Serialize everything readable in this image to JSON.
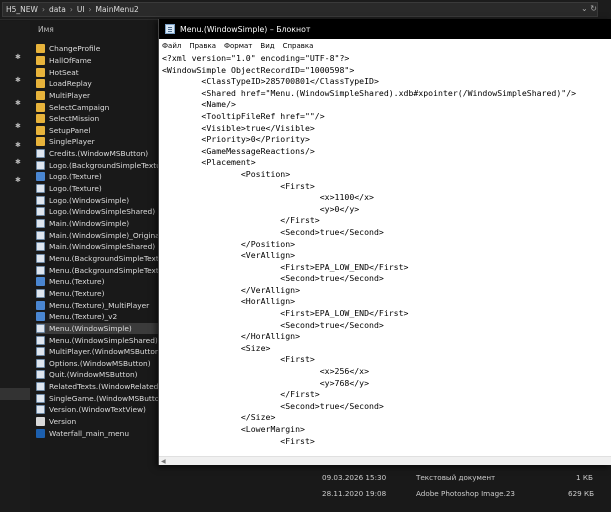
{
  "address_bar": {
    "crumbs": [
      "H5_NEW",
      "data",
      "UI",
      "MainMenu2"
    ]
  },
  "list_header": {
    "name_col": "Имя"
  },
  "files": [
    {
      "name": "ChangeProfile",
      "icon": "folder"
    },
    {
      "name": "HallOfFame",
      "icon": "folder"
    },
    {
      "name": "HotSeat",
      "icon": "folder"
    },
    {
      "name": "LoadReplay",
      "icon": "folder"
    },
    {
      "name": "MultiPlayer",
      "icon": "folder"
    },
    {
      "name": "SelectCampaign",
      "icon": "folder"
    },
    {
      "name": "SelectMission",
      "icon": "folder"
    },
    {
      "name": "SetupPanel",
      "icon": "folder"
    },
    {
      "name": "SinglePlayer",
      "icon": "folder"
    },
    {
      "name": "Credits.(WindowMSButton)",
      "icon": "file"
    },
    {
      "name": "Logo.(BackgroundSimpleTextur",
      "icon": "file"
    },
    {
      "name": "Logo.(Texture)",
      "icon": "img"
    },
    {
      "name": "Logo.(Texture)",
      "icon": "file"
    },
    {
      "name": "Logo.(WindowSimple)",
      "icon": "file"
    },
    {
      "name": "Logo.(WindowSimpleShared)",
      "icon": "file"
    },
    {
      "name": "Main.(WindowSimple)",
      "icon": "file"
    },
    {
      "name": "Main.(WindowSimple)_Original",
      "icon": "file"
    },
    {
      "name": "Main.(WindowSimpleShared)",
      "icon": "file"
    },
    {
      "name": "Menu.(BackgroundSimpleTextu",
      "icon": "file"
    },
    {
      "name": "Menu.(BackgroundSimpleTextu",
      "icon": "file"
    },
    {
      "name": "Menu.(Texture)",
      "icon": "img"
    },
    {
      "name": "Menu.(Texture)",
      "icon": "file"
    },
    {
      "name": "Menu.(Texture)_MultiPlayer",
      "icon": "img"
    },
    {
      "name": "Menu.(Texture)_v2",
      "icon": "img"
    },
    {
      "name": "Menu.(WindowSimple)",
      "icon": "file"
    },
    {
      "name": "Menu.(WindowSimpleShared)",
      "icon": "file"
    },
    {
      "name": "MultiPlayer.(WindowMSButton",
      "icon": "file"
    },
    {
      "name": "Options.(WindowMSButton)",
      "icon": "file"
    },
    {
      "name": "Quit.(WindowMSButton)",
      "icon": "file"
    },
    {
      "name": "RelatedTexts.(WindowRelatedTe",
      "icon": "file"
    },
    {
      "name": "SingleGame.(WindowMSButtor",
      "icon": "file"
    },
    {
      "name": "Version.(WindowTextView)",
      "icon": "file"
    },
    {
      "name": "Version",
      "icon": "plain"
    },
    {
      "name": "Waterfall_main_menu",
      "icon": "psd"
    }
  ],
  "bottom_rows": [
    {
      "date": "09.03.2026 15:30",
      "type": "Текстовый документ",
      "size": "1 КБ"
    },
    {
      "date": "28.11.2020 19:08",
      "type": "Adobe Photoshop Image.23",
      "size": "629 КБ"
    }
  ],
  "notepad": {
    "title": "Menu.(WindowSimple) – Блокнот",
    "menu": [
      "Файл",
      "Правка",
      "Формат",
      "Вид",
      "Справка"
    ],
    "content": "<?xml version=\"1.0\" encoding=\"UTF-8\"?>\n<WindowSimple ObjectRecordID=\"1000598\">\n        <ClassTypeID>285700801</ClassTypeID>\n        <Shared href=\"Menu.(WindowSimpleShared).xdb#xpointer(/WindowSimpleShared)\"/>\n        <Name/>\n        <TooltipFileRef href=\"\"/>\n        <Visible>true</Visible>\n        <Priority>0</Priority>\n        <GameMessageReactions/>\n        <Placement>\n                <Position>\n                        <First>\n                                <x>1100</x>\n                                <y>0</y>\n                        </First>\n                        <Second>true</Second>\n                </Position>\n                <VerAllign>\n                        <First>EPA_LOW_END</First>\n                        <Second>true</Second>\n                </VerAllign>\n                <HorAllign>\n                        <First>EPA_LOW_END</First>\n                        <Second>true</Second>\n                </HorAllign>\n                <Size>\n                        <First>\n                                <x>256</x>\n                                <y>768</y>\n                        </First>\n                        <Second>true</Second>\n                </Size>\n                <LowerMargin>\n                        <First>"
  }
}
